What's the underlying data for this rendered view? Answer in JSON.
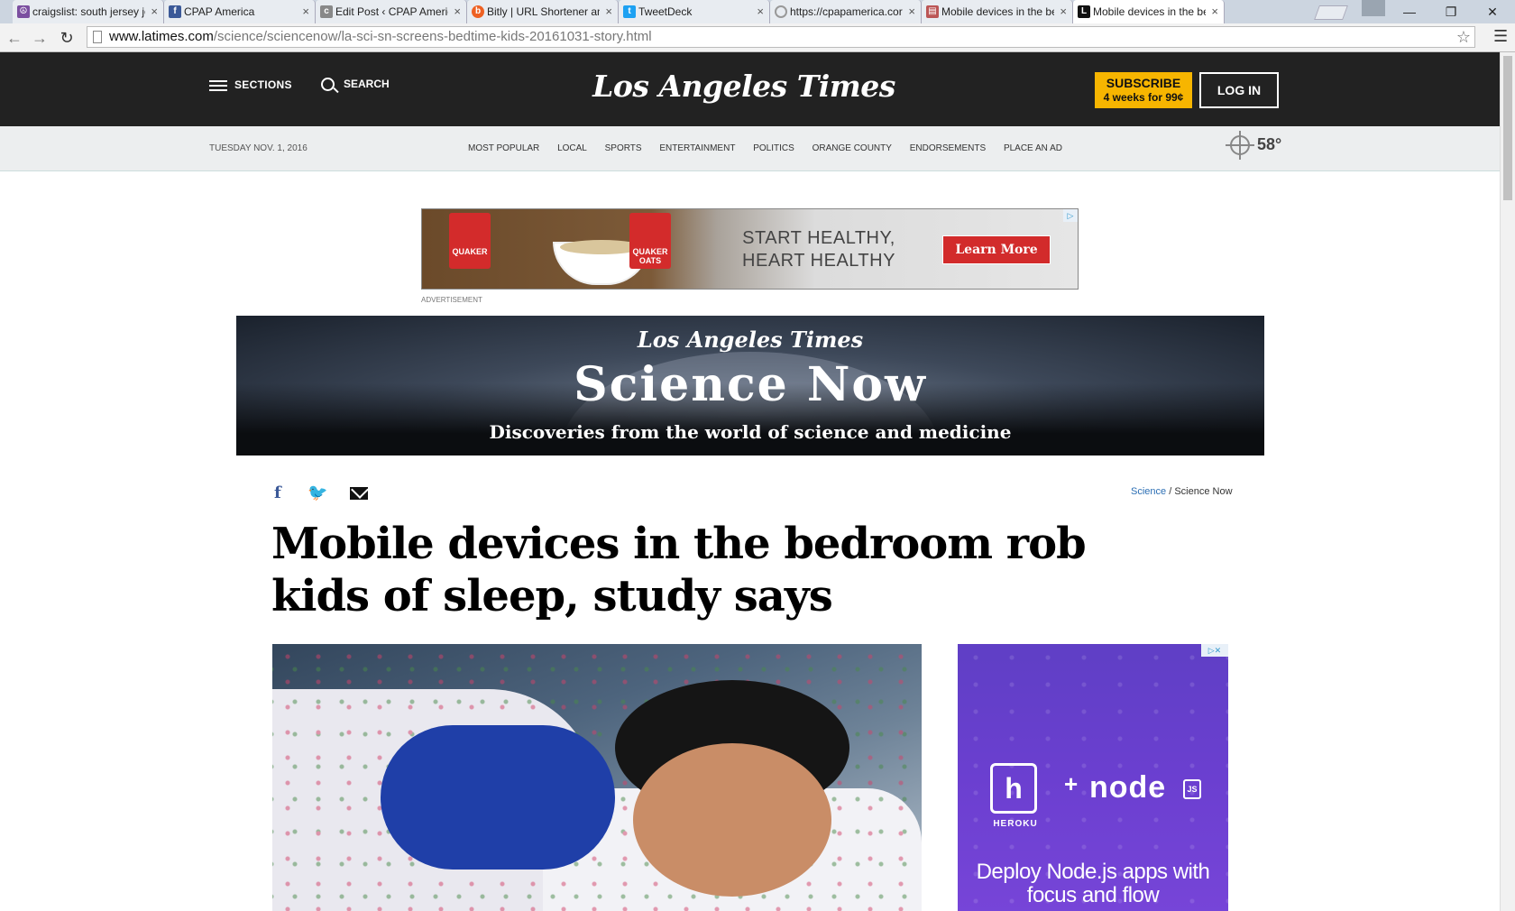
{
  "browser": {
    "tabs": [
      {
        "title": "craigslist: south jersey jo",
        "favicon": "peace-icon",
        "active": false
      },
      {
        "title": "CPAP America",
        "favicon": "facebook-icon",
        "active": false
      },
      {
        "title": "Edit Post ‹ CPAP Americ",
        "favicon": "cpap-icon",
        "active": false
      },
      {
        "title": "Bitly | URL Shortener an",
        "favicon": "bitly-icon",
        "active": false
      },
      {
        "title": "TweetDeck",
        "favicon": "twitter-icon",
        "active": false
      },
      {
        "title": "https://cpapamerica.cor",
        "favicon": "loading-icon",
        "active": false
      },
      {
        "title": "Mobile devices in the be",
        "favicon": "document-icon",
        "active": false
      },
      {
        "title": "Mobile devices in the be",
        "favicon": "latimes-icon",
        "active": true
      }
    ],
    "close_glyph": "×",
    "url_host": "www.latimes.com",
    "url_path": "/science/sciencenow/la-sci-sn-screens-bedtime-kids-20161031-story.html",
    "window_controls": {
      "minimize": "—",
      "restore": "❐",
      "close": "✕"
    }
  },
  "masthead": {
    "sections_label": "SECTIONS",
    "search_label": "SEARCH",
    "logo_text": "Los Angeles Times",
    "subscribe_line1": "SUBSCRIBE",
    "subscribe_line2": "4 weeks for 99¢",
    "login_label": "LOG IN"
  },
  "subnav": {
    "date": "TUESDAY NOV. 1, 2016",
    "links": [
      "MOST POPULAR",
      "LOCAL",
      "SPORTS",
      "ENTERTAINMENT",
      "POLITICS",
      "ORANGE COUNTY",
      "ENDORSEMENTS",
      "PLACE AN AD"
    ],
    "weather_temp": "58°",
    "weather_icon": "sun-icon"
  },
  "ad_quaker": {
    "brand": "QUAKER",
    "brand2": "QUAKER OATS",
    "headline_line1": "START HEALTHY,",
    "headline_line2": "HEART HEALTHY",
    "button_label": "Learn More",
    "label": "ADVERTISEMENT"
  },
  "banner": {
    "logo_text": "Los Angeles Times",
    "title": "Science Now",
    "subtitle": "Discoveries from the world of science and medicine"
  },
  "article": {
    "share_facebook": "f",
    "share_twitter": "🐦",
    "breadcrumb_section": "Science",
    "breadcrumb_sep": " / ",
    "breadcrumb_sub": "Science Now",
    "headline": "Mobile devices in the bedroom rob kids of sleep, study says"
  },
  "ad_heroku": {
    "heroku_letter": "h",
    "heroku_name": "HEROKU",
    "plus": "+",
    "node_text": "node",
    "js_badge": "JS",
    "copy": "Deploy Node.js apps with focus and flow"
  },
  "colors": {
    "masthead_bg": "#222222",
    "subscribe_bg": "#f7b500",
    "ad_button": "#d22b2b",
    "heroku_purple": "#6b3fd0",
    "link_blue": "#2c6fb4"
  }
}
